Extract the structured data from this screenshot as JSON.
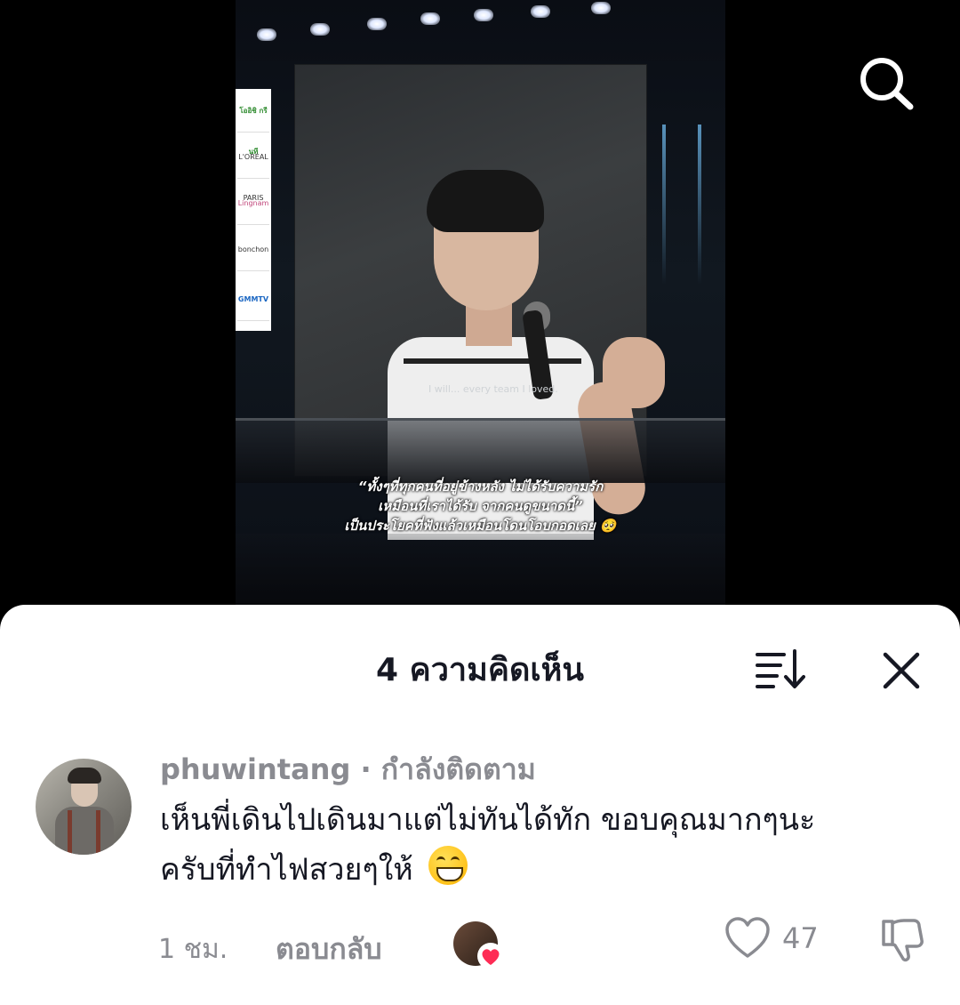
{
  "video": {
    "caption_lines": [
      "“ทั้งๆที่ทุกคนที่อยู่ข้างหลัง ไม่ได้รับความรัก",
      "เหมือนที่เราได้รับ จากคนดูขนาดนี้”",
      "เป็นประโยคที่ฟังแล้วเหมือนโดนโอบกอดเลย 🥺"
    ],
    "screen_caption": "I will... every team  I loved.",
    "sponsors": [
      "โออิชิ กรีนที",
      "L'ORÉAL PARIS",
      "Lingnam",
      "bonchon",
      "GMMTV"
    ]
  },
  "header": {
    "search_icon": "search-icon"
  },
  "comments_sheet": {
    "title": "4 ความคิดเห็น",
    "sort_icon": "sort-icon",
    "close_icon": "close-icon",
    "comment": {
      "username": "phuwintang",
      "separator": "·",
      "following_label": "กำลังติดตาม",
      "text_line1": "เห็นพี่เดินไปเดินมาแต่ไม่ทันได้ทัก ขอบคุณมากๆนะ",
      "text_line2": "ครับที่ทำไฟสวยๆให้",
      "emoji": "grinning-face-emoji",
      "time": "1 ชม.",
      "reply_label": "ตอบกลับ",
      "like_count": "47",
      "liked_by_creator_color": "#fe2c55"
    }
  }
}
